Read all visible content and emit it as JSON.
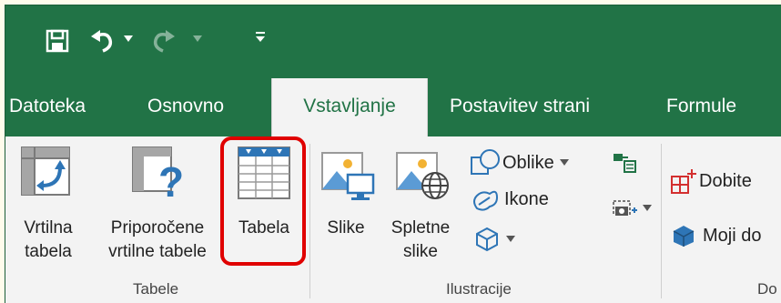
{
  "quick_access": {
    "icons": [
      "save-icon",
      "undo-icon",
      "redo-icon",
      "customize-icon"
    ]
  },
  "tabs": [
    {
      "label": "Datoteka"
    },
    {
      "label": "Osnovno"
    },
    {
      "label": "Vstavljanje",
      "active": true
    },
    {
      "label": "Postavitev strani"
    },
    {
      "label": "Formule"
    }
  ],
  "ribbon": {
    "groups": {
      "tabele": {
        "label": "Tabele",
        "pivot": {
          "line1": "Vrtilna",
          "line2": "tabela"
        },
        "recommended": {
          "line1": "Priporočene",
          "line2": "vrtilne tabele"
        },
        "table": {
          "line1": "Tabela"
        }
      },
      "ilustracije": {
        "label": "Ilustracije",
        "pictures": {
          "line1": "Slike"
        },
        "online_pictures": {
          "line1": "Spletne",
          "line2": "slike"
        },
        "shapes": {
          "label": "Oblike"
        },
        "icons": {
          "label": "Ikone"
        }
      },
      "addins": {
        "label": "Do",
        "get": {
          "label": "Dobite"
        },
        "my": {
          "label": "Moji do"
        }
      }
    }
  },
  "colors": {
    "brand": "#217346",
    "ribbon_bg": "#f3f3f3",
    "highlight": "#e00000"
  }
}
